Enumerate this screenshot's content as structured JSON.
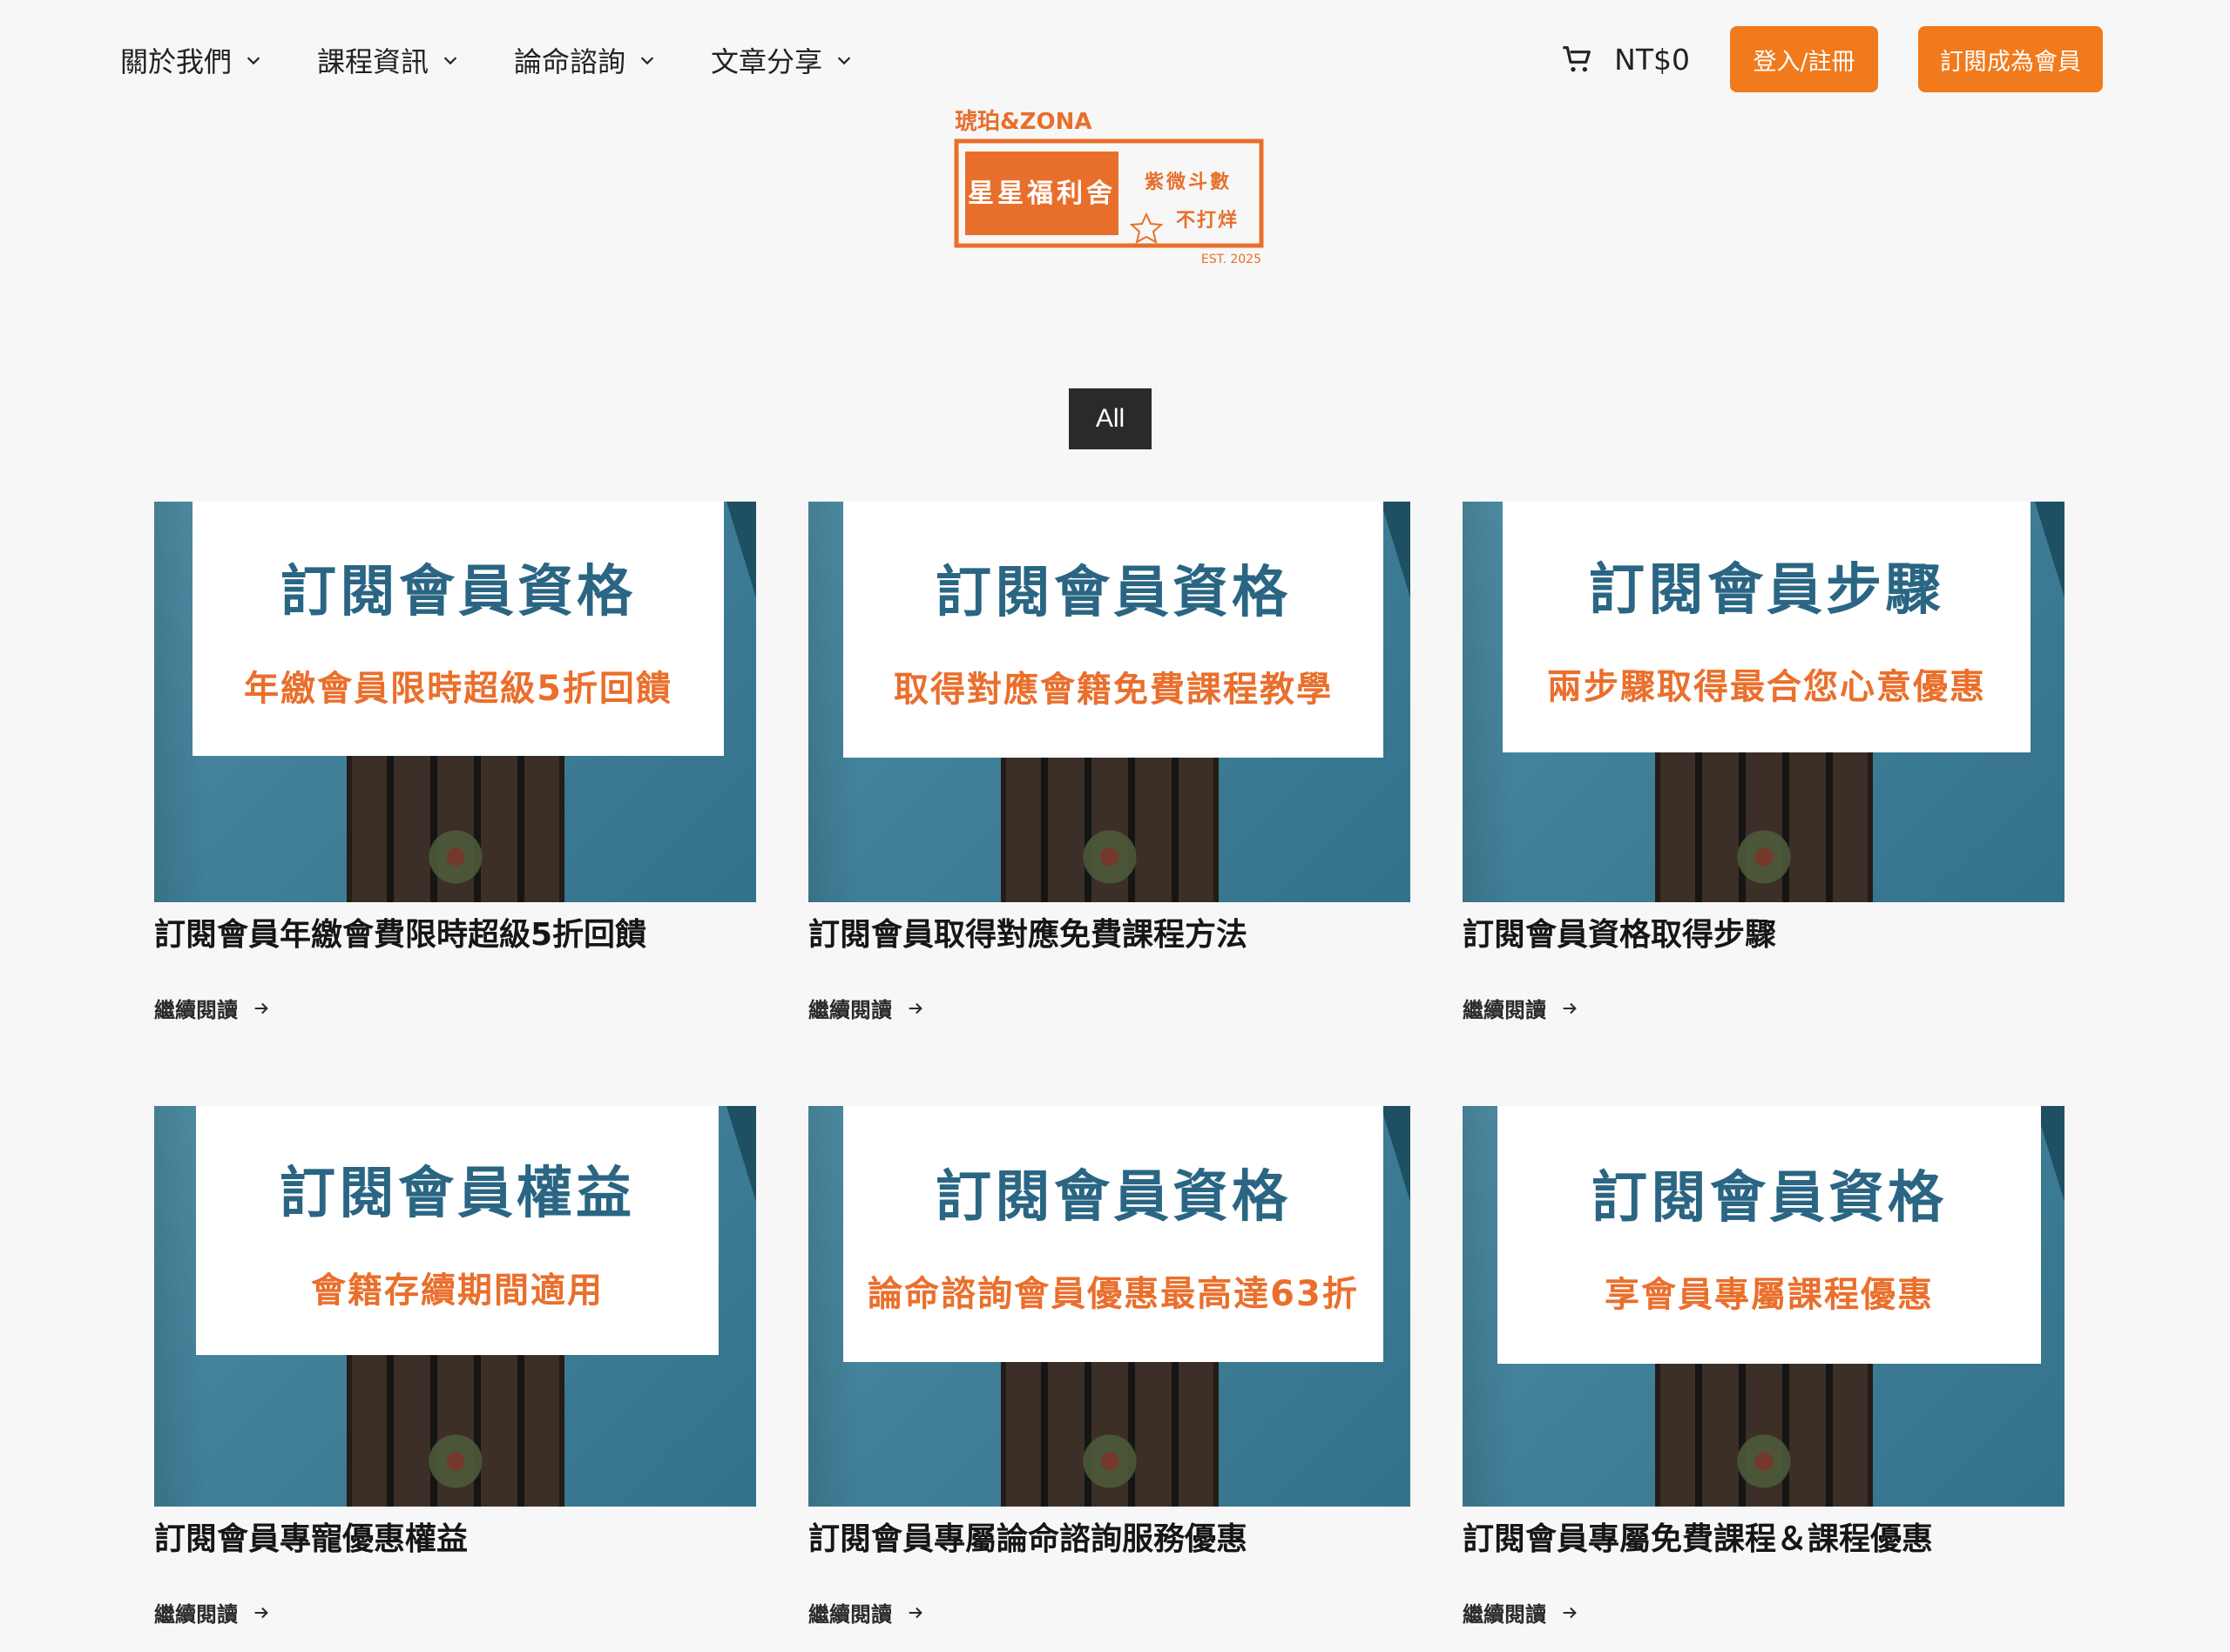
{
  "nav": {
    "items": [
      {
        "label": "關於我們"
      },
      {
        "label": "課程資訊"
      },
      {
        "label": "論命諮詢"
      },
      {
        "label": "文章分享"
      }
    ],
    "cart_amount": "NT$0",
    "login_label": "登入/註冊",
    "subscribe_label": "訂閱成為會員"
  },
  "logo": {
    "top_text": "琥珀&ZONA",
    "badge_text": "星星福利舍",
    "side_line1": "紫微斗數",
    "side_line2": "不打烊",
    "est": "EST. 2025"
  },
  "filter": {
    "all_label": "All"
  },
  "read_more_label": "繼續閱讀",
  "posts": [
    {
      "img_title": "訂閱會員資格",
      "img_subtitle": "年繳會員限時超級5折回饋",
      "title": "訂閱會員年繳會費限時超級5折回饋"
    },
    {
      "img_title": "訂閱會員資格",
      "img_subtitle": "取得對應會籍免費課程教學",
      "title": "訂閱會員取得對應免費課程方法"
    },
    {
      "img_title": "訂閱會員步驟",
      "img_subtitle": "兩步驟取得最合您心意優惠",
      "title": "訂閱會員資格取得步驟"
    },
    {
      "img_title": "訂閱會員權益",
      "img_subtitle": "會籍存續期間適用",
      "title": "訂閱會員專寵優惠權益"
    },
    {
      "img_title": "訂閱會員資格",
      "img_subtitle": "論命諮詢會員優惠最高達63折",
      "title": "訂閱會員專屬論命諮詢服務優惠"
    },
    {
      "img_title": "訂閱會員資格",
      "img_subtitle": "享會員專屬課程優惠",
      "title": "訂閱會員專屬免費課程＆課程優惠"
    }
  ],
  "colors": {
    "accent": "#f07a1c",
    "heading_blue": "#2a6683",
    "subtitle_orange": "#ea6f2c",
    "thumb_teal": "#3f7f97"
  }
}
